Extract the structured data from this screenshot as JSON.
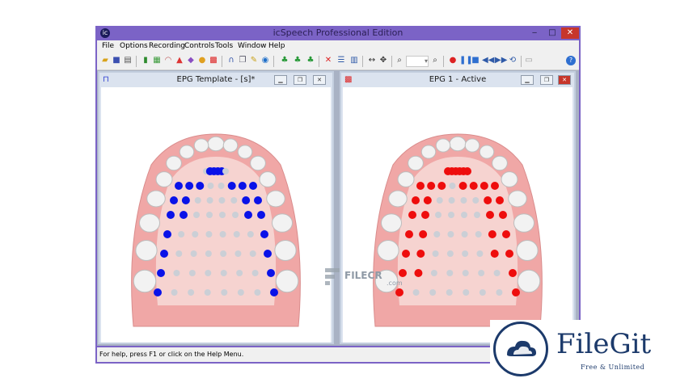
{
  "app": {
    "title": "icSpeech Professional Edition",
    "window_controls": {
      "minimize": "‒",
      "maximize": "□",
      "close": "✕"
    }
  },
  "menu": [
    "File",
    "Options",
    "Recording",
    "Controls",
    "Tools",
    "Window",
    "Help"
  ],
  "toolbar_icons": [
    "open-icon",
    "save-icon",
    "print-icon",
    "bar-chart-icon",
    "grid-icon",
    "palate-icon",
    "spectrum-icon",
    "cube-icon",
    "face-icon",
    "epg-grid-icon",
    "palate-outline-icon",
    "copy-icon",
    "brush-icon",
    "help-bubble-icon",
    "record-green-icon",
    "play-green-icon",
    "step-green-icon",
    "delete-icon",
    "split-horizontal-icon",
    "split-vertical-icon",
    "stretch-horizontal-icon",
    "move-icon",
    "zoom-in-icon",
    "zoom-select",
    "zoom-out-icon",
    "record-icon",
    "pause-icon",
    "stop-icon",
    "rewind-icon",
    "fast-forward-icon",
    "loop-icon",
    "page-icon",
    "help-icon"
  ],
  "windows": [
    {
      "title": "EPG Template - [s]*",
      "active": false,
      "dot_color": "#0a12e8"
    },
    {
      "title": "EPG 1 - Active",
      "active": true,
      "dot_color": "#ee0d0d"
    }
  ],
  "status": "For help, press F1 or click on the Help Menu.",
  "colors": {
    "inactive_dot": "#cbcfd6",
    "gum": "#f0a7a6",
    "palate": "#f6d3d0",
    "tooth": "#f2f2f2"
  },
  "epg_patterns": {
    "template": [
      [
        0,
        1,
        1,
        1,
        1,
        0
      ],
      [
        1,
        1,
        1,
        0,
        0,
        1,
        1,
        1
      ],
      [
        1,
        1,
        0,
        0,
        0,
        0,
        1,
        1
      ],
      [
        1,
        1,
        0,
        0,
        0,
        0,
        1,
        1
      ],
      [
        1,
        0,
        0,
        0,
        0,
        0,
        0,
        1
      ],
      [
        1,
        0,
        0,
        0,
        0,
        0,
        0,
        1
      ],
      [
        1,
        0,
        0,
        0,
        0,
        0,
        0,
        1
      ],
      [
        1,
        0,
        0,
        0,
        0,
        0,
        0,
        1
      ]
    ],
    "active": [
      [
        1,
        1,
        1,
        1,
        1,
        1
      ],
      [
        1,
        1,
        1,
        0,
        1,
        1,
        1,
        1
      ],
      [
        1,
        1,
        0,
        0,
        0,
        0,
        1,
        1
      ],
      [
        1,
        1,
        0,
        0,
        0,
        0,
        1,
        1
      ],
      [
        1,
        1,
        0,
        0,
        0,
        0,
        1,
        1
      ],
      [
        1,
        1,
        0,
        0,
        0,
        0,
        1,
        1
      ],
      [
        1,
        1,
        0,
        0,
        0,
        0,
        0,
        1
      ],
      [
        1,
        0,
        0,
        0,
        0,
        0,
        0,
        1
      ]
    ]
  },
  "watermarks": {
    "filecr": "FILECR",
    "filecr_sub": ".com",
    "filegit_name": "FileGit",
    "filegit_tagline": "Free & Unlimited"
  }
}
